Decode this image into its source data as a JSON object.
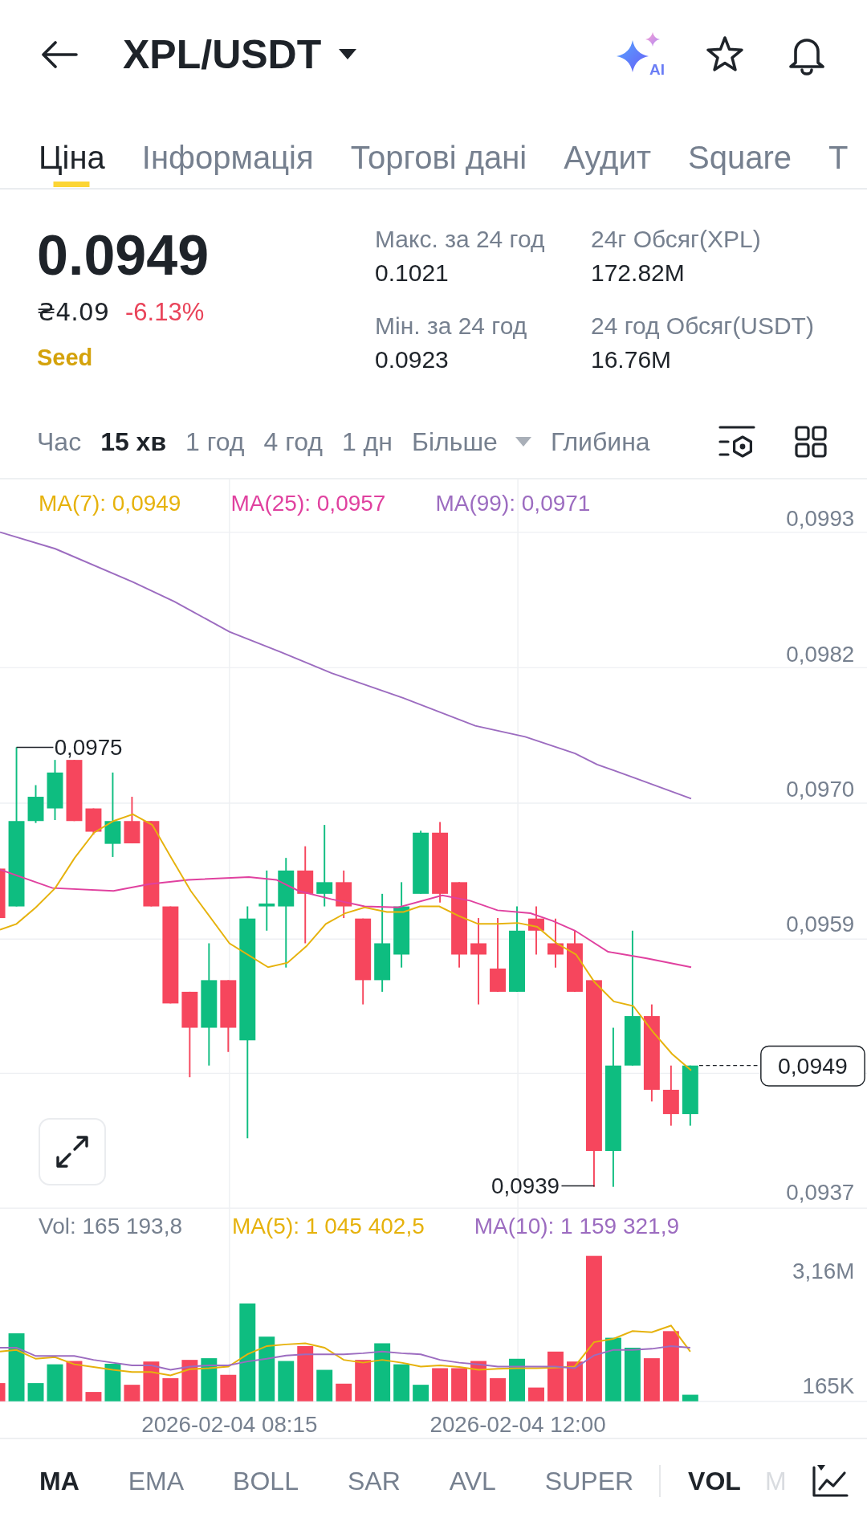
{
  "header": {
    "title": "XPL/USDT",
    "ai_label": "AI"
  },
  "tabs": [
    {
      "label": "Ціна",
      "selected": true
    },
    {
      "label": "Інформація",
      "selected": false
    },
    {
      "label": "Торгові дані",
      "selected": false
    },
    {
      "label": "Аудит",
      "selected": false
    },
    {
      "label": "Square",
      "selected": false
    },
    {
      "label": "T",
      "selected": false
    }
  ],
  "ticker": {
    "last_price": "0.0949",
    "fiat_price": "₴4.09",
    "change": "-6.13%",
    "tag": "Seed"
  },
  "stats": [
    {
      "label": "Макс. за 24 год",
      "value": "0.1021"
    },
    {
      "label": "24г Обсяг(XPL)",
      "value": "172.82M"
    },
    {
      "label": "Мін. за 24 год",
      "value": "0.0923"
    },
    {
      "label": "24 год Обсяг(USDT)",
      "value": "16.76M"
    }
  ],
  "intervals": [
    {
      "label": "Час",
      "kind": "option",
      "selected": false
    },
    {
      "label": "15 хв",
      "kind": "option",
      "selected": true
    },
    {
      "label": "1 год",
      "kind": "option",
      "selected": false
    },
    {
      "label": "4 год",
      "kind": "option",
      "selected": false
    },
    {
      "label": "1 дн",
      "kind": "option",
      "selected": false
    },
    {
      "label": "Більше",
      "kind": "dropdown",
      "selected": false
    },
    {
      "label": "Глибина",
      "kind": "option",
      "selected": false
    }
  ],
  "chart": {
    "legend": [
      {
        "label": "MA(7): 0,0949",
        "color": "#e6b20c"
      },
      {
        "label": "MA(25): 0,0957",
        "color": "#e0419f"
      },
      {
        "label": "MA(99): 0,0971",
        "color": "#9c6cc0"
      }
    ],
    "price_axis": [
      "0,0993",
      "0,0982",
      "0,0970",
      "0,0959",
      "0,0937"
    ],
    "high_label": "0,0975",
    "low_label": "0,0939",
    "current_price": "0,0949"
  },
  "volume": {
    "legend": [
      {
        "label": "Vol: 165 193,8",
        "color": "#76808f"
      },
      {
        "label": "MA(5): 1 045 402,5",
        "color": "#e6b20c"
      },
      {
        "label": "MA(10): 1 159 321,9",
        "color": "#9c6cc0"
      }
    ],
    "axis": [
      "3,16M",
      "165K"
    ],
    "time_axis": [
      "2026-02-04 08:15",
      "2026-02-04 12:00"
    ]
  },
  "main_indicators": [
    {
      "label": "MA",
      "selected": true
    },
    {
      "label": "EMA",
      "selected": false
    },
    {
      "label": "BOLL",
      "selected": false
    },
    {
      "label": "SAR",
      "selected": false
    },
    {
      "label": "AVL",
      "selected": false
    },
    {
      "label": "SUPER",
      "selected": false
    }
  ],
  "sub_indicators": [
    {
      "label": "VOL",
      "selected": true
    },
    {
      "label": "M",
      "selected": false
    }
  ]
}
